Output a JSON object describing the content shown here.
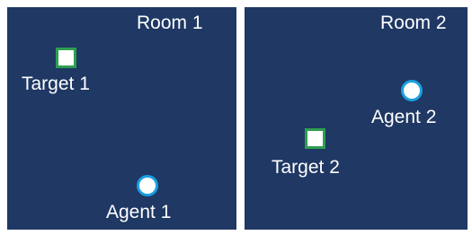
{
  "rooms": [
    {
      "title": "Room 1",
      "target_label": "Target 1",
      "agent_label": "Agent 1"
    },
    {
      "title": "Room 2",
      "target_label": "Target 2",
      "agent_label": "Agent 2"
    }
  ],
  "colors": {
    "room_background": "#1f3864",
    "text": "#ffffff",
    "target_border": "#2e9e4f",
    "agent_border": "#1aa0e0"
  },
  "icons": {
    "target": "square-marker",
    "agent": "circle-marker"
  }
}
